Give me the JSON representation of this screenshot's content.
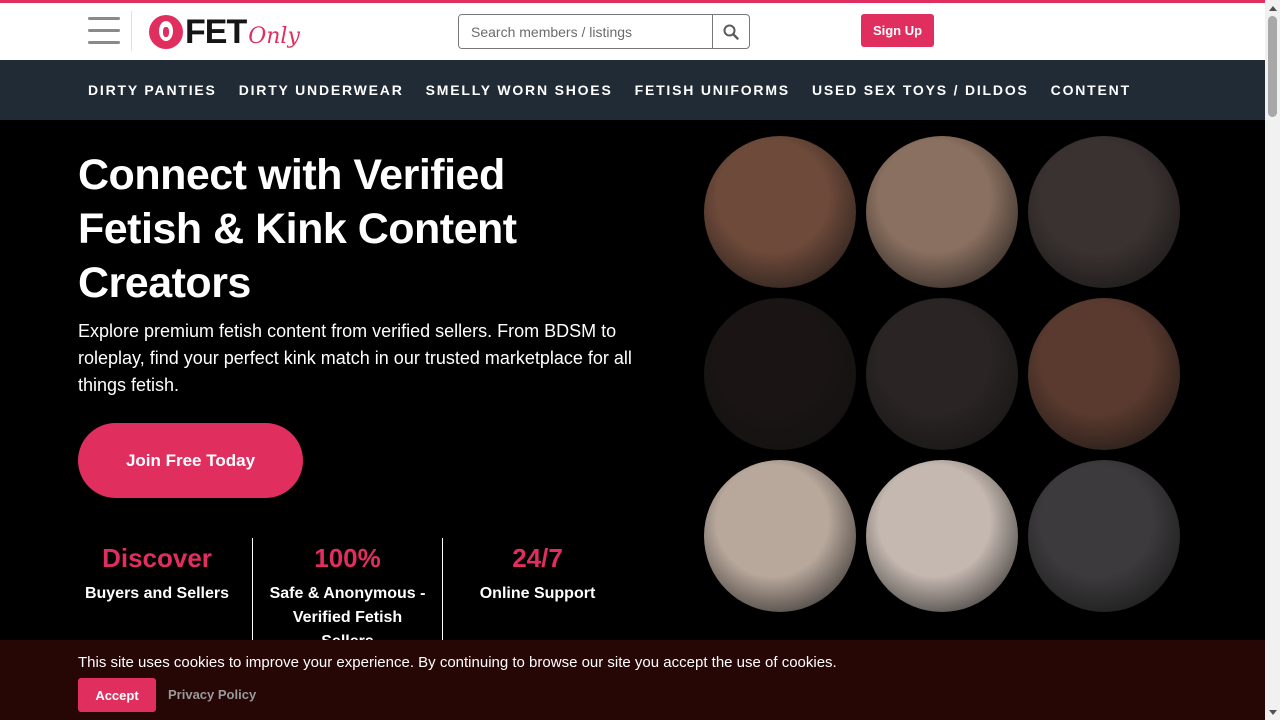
{
  "header": {
    "logo_text": "FET",
    "logo_suffix": "Only",
    "search_placeholder": "Search members / listings",
    "signup_label": "Sign Up"
  },
  "nav": {
    "items": [
      "DIRTY PANTIES",
      "DIRTY UNDERWEAR",
      "SMELLY WORN SHOES",
      "FETISH UNIFORMS",
      "USED SEX TOYS / DILDOS",
      "CONTENT"
    ]
  },
  "hero": {
    "title": "Connect with Verified Fetish & Kink Content Creators",
    "lead": "Explore premium fetish content from verified sellers. From BDSM to roleplay, find your perfect kink match in our trusted marketplace for all things fetish.",
    "cta_label": "Join Free Today"
  },
  "stats": [
    {
      "value": "Discover",
      "label": "Buyers and Sellers"
    },
    {
      "value": "100%",
      "label": "Safe & Anonymous - Verified Fetish Sellers"
    },
    {
      "value": "24/7",
      "label": "Online Support"
    }
  ],
  "gallery": {
    "colors": [
      "#6e4a3a",
      "#8a7060",
      "#3a3230",
      "#1a1414",
      "#2a2424",
      "#5a3a2e",
      "#b8a89c",
      "#c4b8b0",
      "#3c3a3c"
    ]
  },
  "cookie": {
    "text": "This site uses cookies to improve your experience. By continuing to browse our site you accept the use of cookies.",
    "accept_label": "Accept",
    "privacy_label": "Privacy Policy"
  },
  "colors": {
    "accent": "#e02e5f",
    "nav_bg": "#212b36",
    "cookie_bg": "#270606"
  }
}
